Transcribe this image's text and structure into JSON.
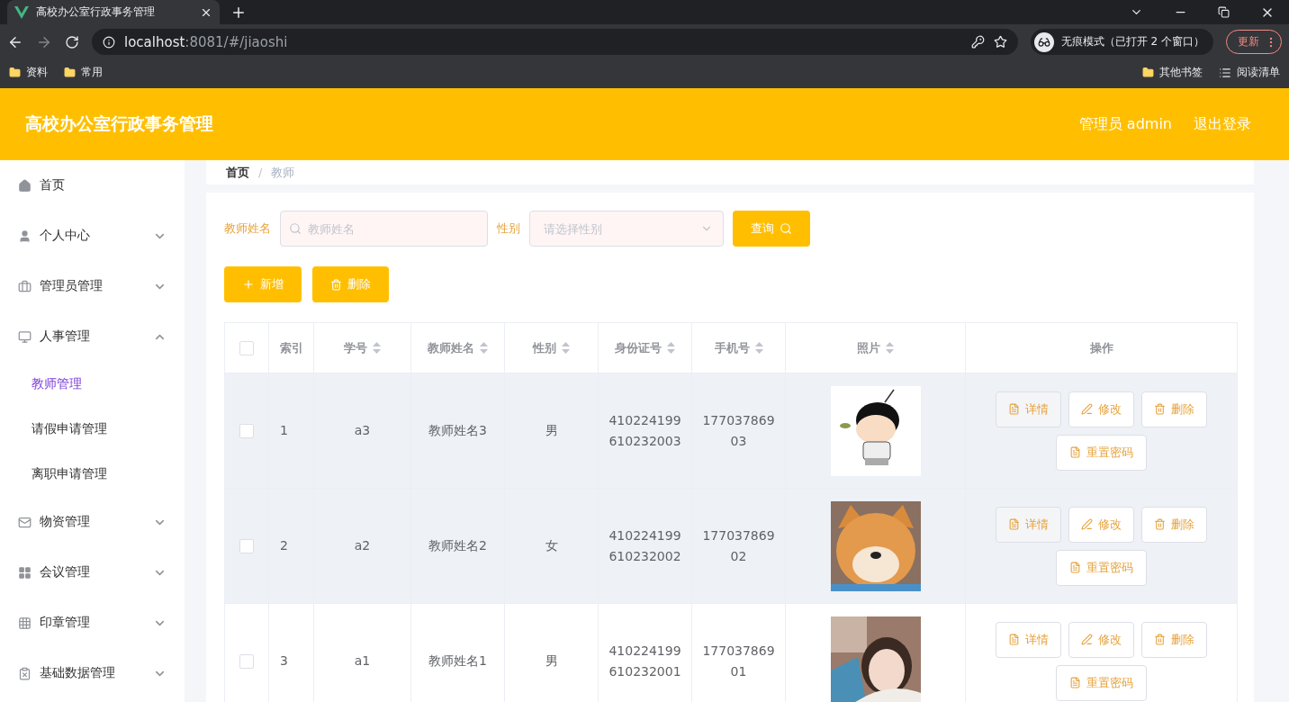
{
  "browser": {
    "tab_title": "高校办公室行政事务管理",
    "url_host": "localhost",
    "url_rest": ":8081/#/jiaoshi",
    "incognito": "无痕模式（已打开 2 个窗口）",
    "update_button": "更新",
    "bookmarks": [
      "资料",
      "常用"
    ],
    "other_bookmarks": "其他书签",
    "reading_list": "阅读清单"
  },
  "header": {
    "title": "高校办公室行政事务管理",
    "user": "管理员 admin",
    "logout": "退出登录"
  },
  "sidebar": {
    "items": [
      {
        "label": "首页",
        "kind": "home"
      },
      {
        "label": "个人中心",
        "kind": "user",
        "expanded": false
      },
      {
        "label": "管理员管理",
        "kind": "briefcase",
        "expanded": false
      },
      {
        "label": "人事管理",
        "kind": "monitor",
        "expanded": true,
        "children": [
          {
            "label": "教师管理",
            "selected": true
          },
          {
            "label": "请假申请管理",
            "selected": false
          },
          {
            "label": "离职申请管理",
            "selected": false
          }
        ]
      },
      {
        "label": "物资管理",
        "kind": "mail",
        "expanded": false
      },
      {
        "label": "会议管理",
        "kind": "grid",
        "expanded": false
      },
      {
        "label": "印章管理",
        "kind": "dots",
        "expanded": false
      },
      {
        "label": "基础数据管理",
        "kind": "clipboard",
        "expanded": false
      }
    ]
  },
  "breadcrumb": [
    "首页",
    "教师"
  ],
  "breadcrumb_separator": "/",
  "filters": {
    "name_label": "教师姓名",
    "name_placeholder": "教师姓名",
    "gender_label": "性别",
    "gender_placeholder": "请选择性别",
    "search_button": "查询"
  },
  "actions": [
    {
      "label": "新增",
      "kind": "add"
    },
    {
      "label": "删除",
      "kind": "delete"
    }
  ],
  "table": {
    "select_all_checked": false,
    "columns": [
      {
        "label": "索引",
        "sortable": false
      },
      {
        "label": "学号",
        "sortable": true
      },
      {
        "label": "教师姓名",
        "sortable": true
      },
      {
        "label": "性别",
        "sortable": true
      },
      {
        "label": "身份证号",
        "sortable": true
      },
      {
        "label": "手机号",
        "sortable": true
      },
      {
        "label": "照片",
        "sortable": true
      },
      {
        "label": "操作",
        "sortable": false
      }
    ],
    "rows": [
      {
        "checked": false,
        "highlighted": true,
        "index": "1",
        "id": "a3",
        "name": "教师姓名3",
        "gender": "男",
        "id_card": "410224199610232003",
        "phone": "17703786903",
        "photo": {
          "kind": "cartoon"
        },
        "buttons": [
          {
            "label": "详情",
            "kind": "detail"
          },
          {
            "label": "修改",
            "kind": "edit"
          },
          {
            "label": "删除",
            "kind": "delete"
          },
          {
            "label": "重置密码",
            "kind": "reset"
          }
        ]
      },
      {
        "checked": false,
        "highlighted": true,
        "index": "2",
        "id": "a2",
        "name": "教师姓名2",
        "gender": "女",
        "id_card": "410224199610232002",
        "phone": "17703786902",
        "photo": {
          "kind": "dog"
        },
        "buttons": [
          {
            "label": "详情",
            "kind": "detail"
          },
          {
            "label": "修改",
            "kind": "edit"
          },
          {
            "label": "删除",
            "kind": "delete"
          },
          {
            "label": "重置密码",
            "kind": "reset"
          }
        ]
      },
      {
        "checked": false,
        "highlighted": false,
        "index": "3",
        "id": "a1",
        "name": "教师姓名1",
        "gender": "男",
        "id_card": "410224199610232001",
        "phone": "17703786901",
        "photo": {
          "kind": "person"
        },
        "buttons": [
          {
            "label": "详情",
            "kind": "detail"
          },
          {
            "label": "修改",
            "kind": "edit"
          },
          {
            "label": "删除",
            "kind": "delete"
          },
          {
            "label": "重置密码",
            "kind": "reset"
          }
        ]
      }
    ]
  }
}
